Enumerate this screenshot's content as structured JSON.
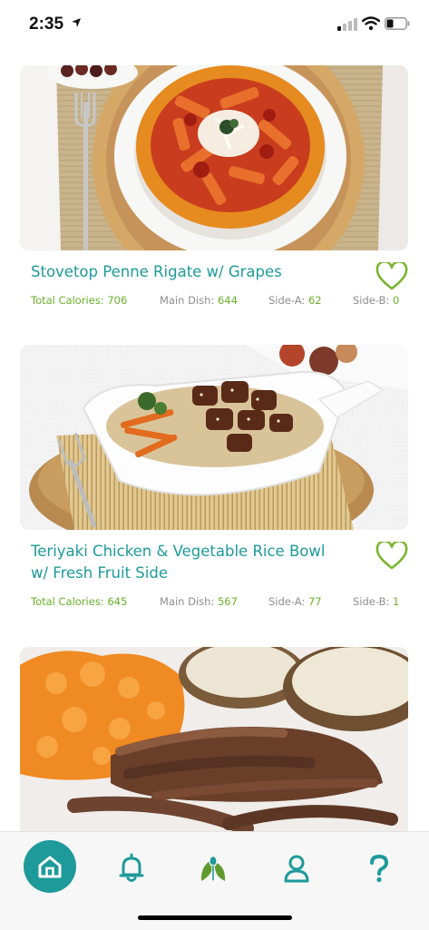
{
  "status": {
    "time": "2:35"
  },
  "colors": {
    "accent": "#1e9a9a",
    "green": "#6ab02a",
    "muted": "#8e8e8e"
  },
  "recipes": [
    {
      "title": "Stovetop Penne Rigate w/ Grapes",
      "image": "penne-pasta-bowl",
      "total_calories_label": "Total Calories: 706",
      "main_label": "Main Dish:",
      "main_value": "644",
      "side_a_label": "Side-A:",
      "side_a_value": "62",
      "side_b_label": "Side-B:",
      "side_b_value": "0"
    },
    {
      "title": "Teriyaki Chicken & Vegetable Rice Bowl w/ Fresh Fruit Side",
      "image": "teriyaki-rice-bowl",
      "total_calories_label": "Total Calories: 645",
      "main_label": "Main Dish:",
      "main_value": "567",
      "side_a_label": "Side-A:",
      "side_a_value": "77",
      "side_b_label": "Side-B:",
      "side_b_value": "1"
    },
    {
      "title": "",
      "image": "steak-with-sweet-potato"
    }
  ],
  "tabs": [
    {
      "name": "home",
      "icon": "home-icon",
      "active": true
    },
    {
      "name": "notifications",
      "icon": "bell-icon",
      "active": false
    },
    {
      "name": "meals",
      "icon": "leaf-spoon-icon",
      "active": false
    },
    {
      "name": "profile",
      "icon": "person-icon",
      "active": false
    },
    {
      "name": "help",
      "icon": "question-icon",
      "active": false
    }
  ]
}
